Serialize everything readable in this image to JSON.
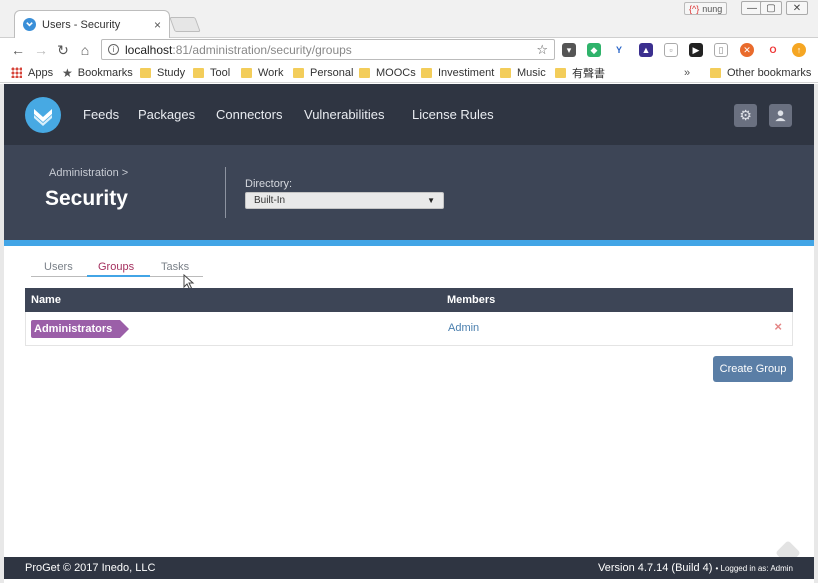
{
  "browser": {
    "tab_title": "Users - Security",
    "tab_close": "×",
    "profile_name": "nung",
    "url_host": "localhost",
    "url_path": ":81/administration/security/groups",
    "bookmarks": [
      {
        "label": "Apps"
      },
      {
        "label": "Bookmarks"
      },
      {
        "label": "Study"
      },
      {
        "label": "Tool"
      },
      {
        "label": "Work"
      },
      {
        "label": "Personal"
      },
      {
        "label": "MOOCs"
      },
      {
        "label": "Investiment"
      },
      {
        "label": "Music"
      },
      {
        "label": "有聲書"
      }
    ],
    "more_bookmarks": "»",
    "other_bookmarks": "Other bookmarks"
  },
  "nav": {
    "items": [
      "Feeds",
      "Packages",
      "Connectors",
      "Vulnerabilities",
      "License Rules"
    ]
  },
  "header": {
    "breadcrumb": "Administration >",
    "title": "Security",
    "directory_label": "Directory:",
    "directory_value": "Built-In"
  },
  "tabs": [
    "Users",
    "Groups",
    "Tasks"
  ],
  "table": {
    "columns": [
      "Name",
      "Members"
    ],
    "rows": [
      {
        "name": "Administrators",
        "members": "Admin"
      }
    ]
  },
  "actions": {
    "create_group": "Create Group",
    "delete_symbol": "×"
  },
  "footer": {
    "copyright": "ProGet © 2017 Inedo, LLC",
    "version": "Version 4.7.14 (Build 4)",
    "logged_in": "• Logged in as: Admin"
  },
  "colors": {
    "header_bg": "#2f3542",
    "subheader_bg": "#3d4556",
    "accent_blue": "#42a5e6",
    "group_tag": "#9b5fa8",
    "active_tab": "#a4305e",
    "button": "#5a7ea6"
  }
}
